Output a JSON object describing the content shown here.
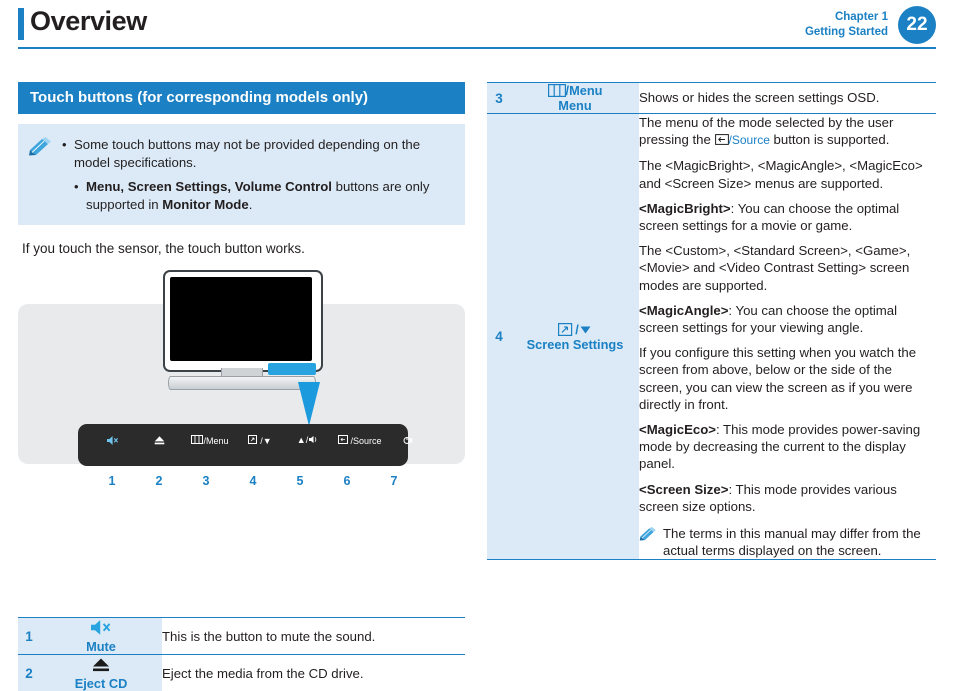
{
  "header": {
    "title": "Overview",
    "chapter_line1": "Chapter 1",
    "chapter_line2": "Getting Started",
    "page_number": "22"
  },
  "left": {
    "section_heading": "Touch buttons (for corresponding models only)",
    "note": {
      "bullet1": "Some touch buttons may not be provided depending on the model specifications.",
      "bullet2_pre": "",
      "bullet2_bold1": "Menu, Screen Settings, Volume Control",
      "bullet2_mid": " buttons are only supported in ",
      "bullet2_bold2": "Monitor Mode",
      "bullet2_end": "."
    },
    "body_line": "If you touch the sensor, the touch button works.",
    "illustration": {
      "buttons": [
        {
          "label": "◁×",
          "number": "1"
        },
        {
          "label": "⏏",
          "number": "2"
        },
        {
          "label": "/Menu",
          "number": "3"
        },
        {
          "label": "/▼",
          "number": "4"
        },
        {
          "label": "▲/",
          "number": "5"
        },
        {
          "label": "/Source",
          "number": "6"
        },
        {
          "label": "☼×",
          "number": "7"
        }
      ]
    },
    "rows": [
      {
        "number": "1",
        "icon_label": "Mute",
        "description": "This is the button to mute the sound."
      },
      {
        "number": "2",
        "icon_label": "Eject CD",
        "description": "Eject the media from the CD drive."
      }
    ]
  },
  "right": {
    "rows": [
      {
        "number": "3",
        "icon_label_line1": "/Menu",
        "icon_label_line2": "Menu",
        "paragraphs": [
          "Shows or hides the screen settings OSD."
        ]
      },
      {
        "number": "4",
        "icon_label_line1": "/",
        "icon_label_line2": "Screen Settings",
        "paragraphs": [
          "The menu of the mode selected by the user pressing the  /Source button is supported.",
          "The <MagicBright>, <MagicAngle>, <MagicEco> and <Screen Size> menus are supported.",
          "<MagicBright>: You can choose the optimal screen settings for a movie or game.",
          "The <Custom>, <Standard Screen>, <Game>, <Movie> and <Video Contrast Setting> screen modes are supported.",
          "<MagicAngle>:  You can choose the optimal screen settings for your viewing angle.",
          "If you configure this setting when you watch the screen from above, below or the side of the screen, you can view the screen as if you were directly in front.",
          "<MagicEco>: This mode provides power-saving mode by decreasing the current to the display panel.",
          "<Screen Size>: This mode provides various screen size options."
        ],
        "bold_terms": [
          "<MagicBright>",
          "<MagicAngle>",
          "<MagicEco>",
          "<Screen Size>"
        ],
        "source_label": "/Source",
        "note": "The terms in this manual may differ from the actual terms displayed on the screen."
      }
    ]
  },
  "colors": {
    "accent": "#1b80c4",
    "note_bg": "#dbeaf6",
    "text": "#231f20"
  }
}
